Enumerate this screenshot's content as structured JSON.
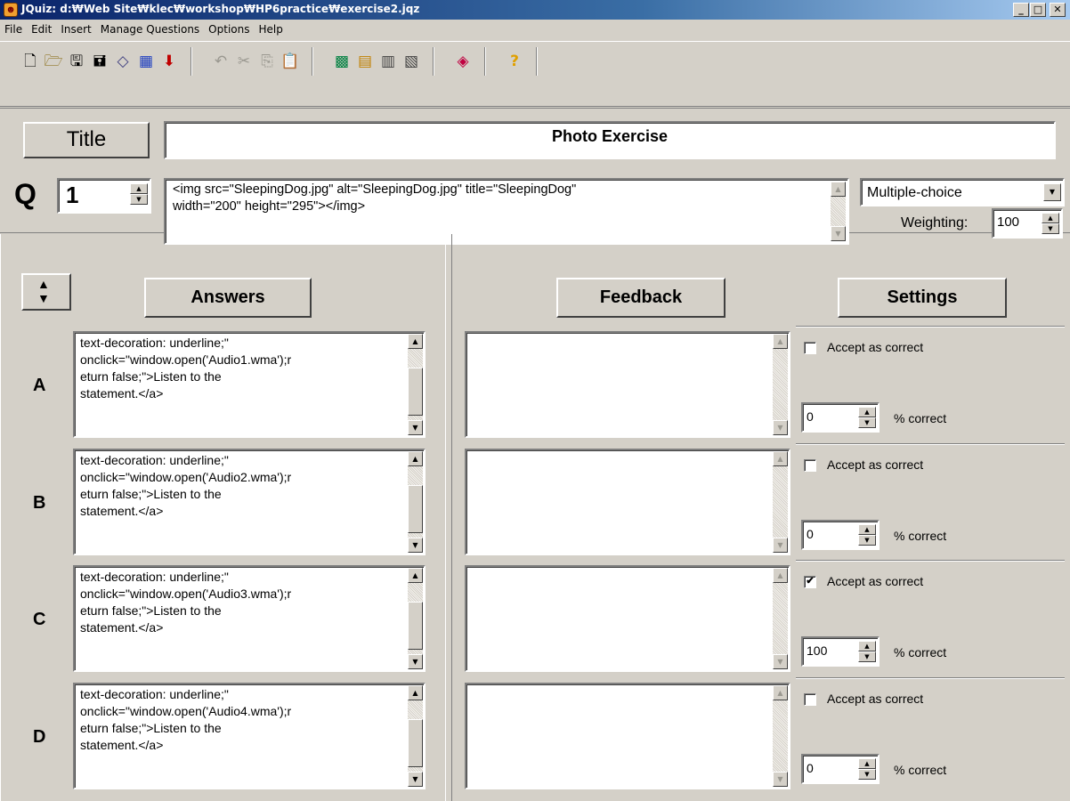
{
  "window": {
    "title": "JQuiz: d:₩Web Site₩klec₩workshop₩HP6practice₩exercise2.jqz",
    "minimize": "_",
    "maximize": "□",
    "close": "✕"
  },
  "menu": [
    "File",
    "Edit",
    "Insert",
    "Manage Questions",
    "Options",
    "Help"
  ],
  "toolbar": {
    "icons": [
      "new-file-icon",
      "open-folder-icon",
      "save-icon",
      "save-as-icon",
      "eraser-icon",
      "web-export-icon",
      "arrow-down-icon",
      "undo-icon",
      "cut-icon",
      "copy-icon",
      "paste-icon",
      "image-icon",
      "insert-icon",
      "table-icon",
      "link-icon",
      "config-icon",
      "help-icon"
    ]
  },
  "header": {
    "title_button": "Title",
    "title_value": "Photo Exercise",
    "q_label": "Q",
    "q_number": "1",
    "question_text": "<img src=\"SleepingDog.jpg\" alt=\"SleepingDog.jpg\" title=\"SleepingDog\"\nwidth=\"200\" height=\"295\"></img>",
    "question_type": "Multiple-choice",
    "weighting_label": "Weighting:",
    "weighting_value": "100"
  },
  "columns": {
    "answers": "Answers",
    "feedback": "Feedback",
    "settings": "Settings"
  },
  "answers": [
    {
      "letter": "A",
      "text": "text-decoration: underline;\"\nonclick=\"window.open('Audio1.wma');r\neturn false;\">Listen to the\nstatement.</a>",
      "feedback": "",
      "accept_label": "Accept as correct",
      "accepted": false,
      "percent": "0",
      "percent_label": "% correct"
    },
    {
      "letter": "B",
      "text": "text-decoration: underline;\"\nonclick=\"window.open('Audio2.wma');r\neturn false;\">Listen to the\nstatement.</a>",
      "feedback": "",
      "accept_label": "Accept as correct",
      "accepted": false,
      "percent": "0",
      "percent_label": "% correct"
    },
    {
      "letter": "C",
      "text": "text-decoration: underline;\"\nonclick=\"window.open('Audio3.wma');r\neturn false;\">Listen to the\nstatement.</a>",
      "feedback": "",
      "accept_label": "Accept as correct",
      "accepted": true,
      "percent": "100",
      "percent_label": "% correct"
    },
    {
      "letter": "D",
      "text": "text-decoration: underline;\"\nonclick=\"window.open('Audio4.wma');r\neturn false;\">Listen to the\nstatement.</a>",
      "feedback": "",
      "accept_label": "Accept as correct",
      "accepted": false,
      "percent": "0",
      "percent_label": "% correct"
    }
  ]
}
